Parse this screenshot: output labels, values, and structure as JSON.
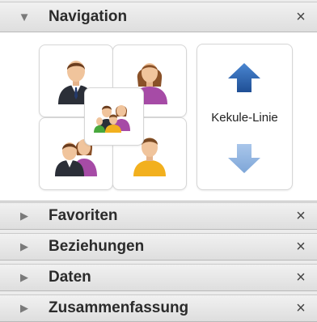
{
  "navigation": {
    "title": "Navigation",
    "close_symbol": "×",
    "tiles": [
      {
        "name": "father",
        "icon": "man-suit-icon"
      },
      {
        "name": "mother",
        "icon": "woman-purple-icon"
      },
      {
        "name": "family",
        "icon": "family-group-icon"
      },
      {
        "name": "parents",
        "icon": "couple-icon"
      },
      {
        "name": "child",
        "icon": "boy-yellow-icon"
      }
    ],
    "kekule": {
      "label": "Kekule-Linie",
      "up_icon": "arrow-up-icon",
      "down_icon": "arrow-down-icon"
    }
  },
  "sections": [
    {
      "title": "Favoriten",
      "close_symbol": "×"
    },
    {
      "title": "Beziehungen",
      "close_symbol": "×"
    },
    {
      "title": "Daten",
      "close_symbol": "×"
    },
    {
      "title": "Zusammenfassung",
      "close_symbol": "×"
    }
  ],
  "colors": {
    "header_gradient_top": "#f1f1f1",
    "header_gradient_bottom": "#dedede",
    "arrow_up": "#2f69b3",
    "arrow_down": "#8fb3e0"
  }
}
